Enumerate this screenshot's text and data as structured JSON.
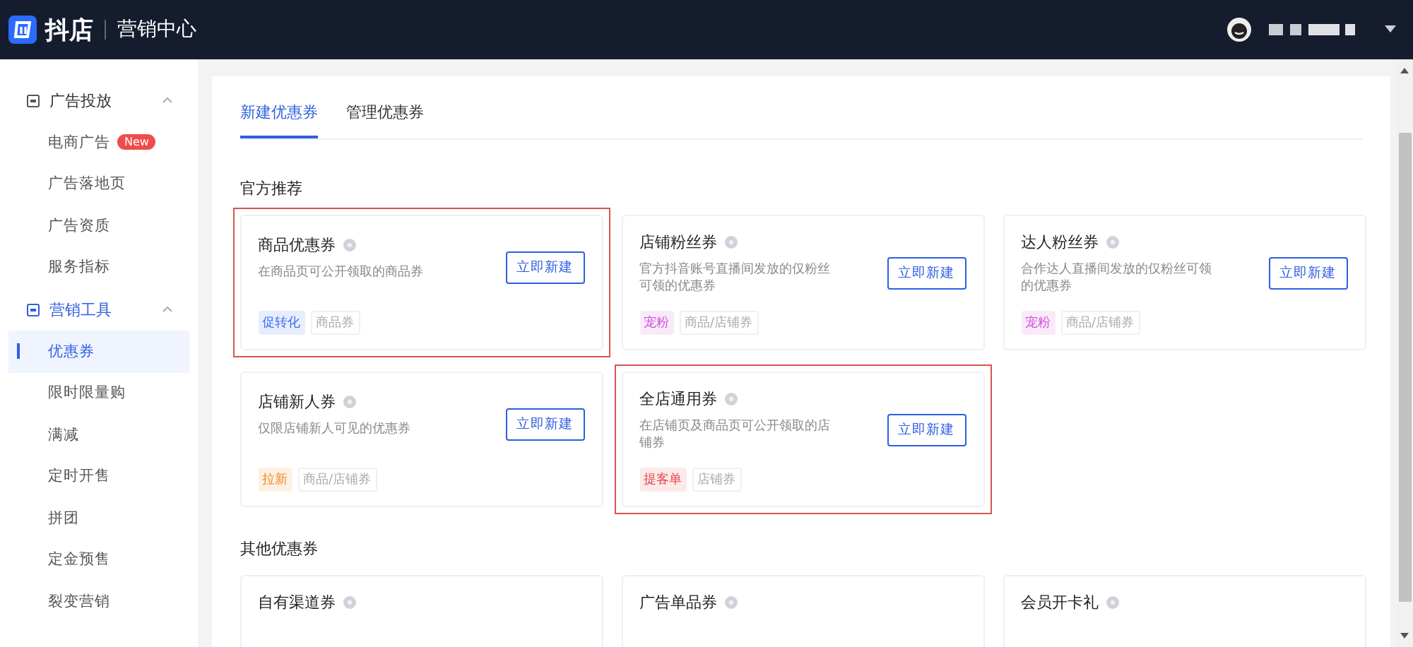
{
  "header": {
    "logo": "抖店",
    "title": "营销中心"
  },
  "sidebar": {
    "groups": [
      {
        "label": "广告投放",
        "expanded": true,
        "active": false,
        "items": [
          {
            "label": "电商广告",
            "badge": "New",
            "selected": false
          },
          {
            "label": "广告落地页",
            "selected": false
          },
          {
            "label": "广告资质",
            "selected": false
          },
          {
            "label": "服务指标",
            "selected": false
          }
        ]
      },
      {
        "label": "营销工具",
        "expanded": true,
        "active": true,
        "items": [
          {
            "label": "优惠券",
            "selected": true
          },
          {
            "label": "限时限量购",
            "selected": false
          },
          {
            "label": "满减",
            "selected": false
          },
          {
            "label": "定时开售",
            "selected": false
          },
          {
            "label": "拼团",
            "selected": false
          },
          {
            "label": "定金预售",
            "selected": false
          },
          {
            "label": "裂变营销",
            "selected": false
          }
        ]
      }
    ]
  },
  "tabs": [
    {
      "label": "新建优惠券",
      "selected": true
    },
    {
      "label": "管理优惠券",
      "selected": false
    }
  ],
  "sections": [
    {
      "title": "官方推荐",
      "cards": [
        {
          "title": "商品优惠券",
          "description": "在商品页可公开领取的商品券",
          "button": "立即新建",
          "highlighted": true,
          "tag": {
            "label": "促转化",
            "color": "#3c6df0"
          },
          "scope": "商品券"
        },
        {
          "title": "店铺粉丝券",
          "description": "官方抖音账号直播间发放的仅粉丝可领的优惠券",
          "button": "立即新建",
          "highlighted": false,
          "tag": {
            "label": "宠粉",
            "color": "#d050d6"
          },
          "scope": "商品/店铺券"
        },
        {
          "title": "达人粉丝券",
          "description": "合作达人直播间发放的仅粉丝可领的优惠券",
          "button": "立即新建",
          "highlighted": false,
          "tag": {
            "label": "宠粉",
            "color": "#d050d6"
          },
          "scope": "商品/店铺券"
        },
        {
          "title": "店铺新人券",
          "description": "仅限店铺新人可见的优惠券",
          "button": "立即新建",
          "highlighted": false,
          "tag": {
            "label": "拉新",
            "color": "#f08a24"
          },
          "scope": "商品/店铺券"
        },
        {
          "title": "全店通用券",
          "description": "在店铺页及商品页可公开领取的店铺券",
          "button": "立即新建",
          "highlighted": true,
          "tag": {
            "label": "提客单",
            "color": "#e5484d"
          },
          "scope": "店铺券"
        }
      ]
    },
    {
      "title": "其他优惠券",
      "cards": [
        {
          "title": "自有渠道券",
          "highlighted": false
        },
        {
          "title": "广告单品券",
          "highlighted": false
        },
        {
          "title": "会员开卡礼",
          "highlighted": false
        }
      ]
    }
  ]
}
